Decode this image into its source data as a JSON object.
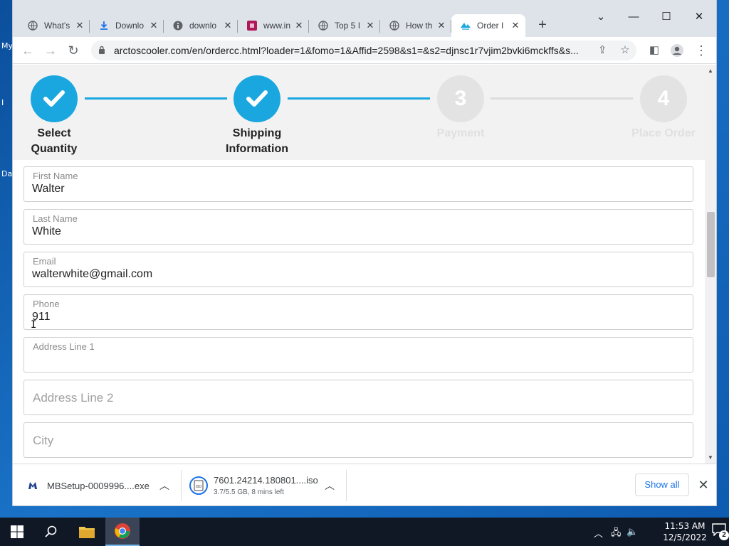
{
  "desktop": {
    "fragments": [
      "My",
      "I",
      "Da"
    ]
  },
  "tabs": [
    {
      "title": "What's",
      "icon": "globe-icon"
    },
    {
      "title": "Downlo",
      "icon": "download-icon"
    },
    {
      "title": "downlo",
      "icon": "info-icon"
    },
    {
      "title": "www.in",
      "icon": "pink-site-icon"
    },
    {
      "title": "Top 5 I",
      "icon": "globe-icon"
    },
    {
      "title": "How th",
      "icon": "globe-icon"
    },
    {
      "title": "Order I",
      "icon": "arctos-icon",
      "active": true
    }
  ],
  "window_controls": {
    "dropdown": "⌄",
    "minimize": "—",
    "maximize": "☐",
    "close": "✕"
  },
  "toolbar": {
    "url": "arctoscooler.com/en/ordercc.html?loader=1&fomo=1&Affid=2598&s1=&s2=djnsc1r7vjim2bvki6mckffs&s..."
  },
  "steps": [
    {
      "number": "",
      "label_line1": "Select",
      "label_line2": "Quantity",
      "state": "done"
    },
    {
      "number": "",
      "label_line1": "Shipping",
      "label_line2": "Information",
      "state": "done"
    },
    {
      "number": "3",
      "label_line1": "Payment",
      "label_line2": "",
      "state": "todo"
    },
    {
      "number": "4",
      "label_line1": "Place Order",
      "label_line2": "",
      "state": "todo"
    }
  ],
  "form": {
    "first_name": {
      "label": "First Name",
      "value": "Walter"
    },
    "last_name": {
      "label": "Last Name",
      "value": "White"
    },
    "email": {
      "label": "Email",
      "value": "walterwhite@gmail.com"
    },
    "phone": {
      "label": "Phone",
      "value": "911"
    },
    "address1": {
      "label": "Address Line 1",
      "value": ""
    },
    "address2": {
      "placeholder": "Address Line 2"
    },
    "city": {
      "placeholder": "City"
    }
  },
  "downloads": [
    {
      "name": "MBSetup-0009996....exe",
      "sub": "",
      "icon": "malwarebytes-icon"
    },
    {
      "name": "7601.24214.180801....iso",
      "sub": "3.7/5.5 GB, 8 mins left",
      "icon": "iso-file-icon"
    }
  ],
  "shelf": {
    "show_all": "Show all"
  },
  "taskbar": {
    "time": "11:53 AM",
    "date": "12/5/2022",
    "notification_count": "2"
  },
  "colors": {
    "accent": "#1aa7e0",
    "inactive_step": "#e3e3e3"
  }
}
